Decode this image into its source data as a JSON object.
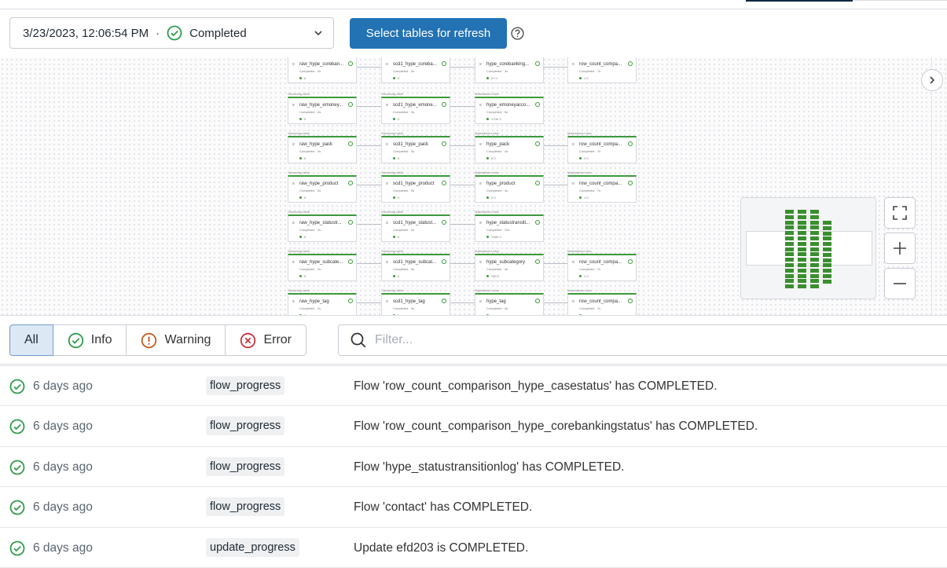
{
  "update_selector": {
    "datetime": "3/23/2023, 12:06:54 PM",
    "separator": "·",
    "status": "Completed"
  },
  "refresh_button": "Select tables for refresh",
  "graph": {
    "rows": [
      {
        "type": [
          "",
          "",
          "",
          ""
        ],
        "names": [
          "raw_hype_coreban...",
          "scd1_hype_coreba...",
          "hype_corebanking...",
          "row_count_compa..."
        ],
        "status": [
          "Completed · 2s",
          "Completed · 3s",
          "Completed · 3s",
          "Completed · 7s"
        ],
        "metrics": [
          "0",
          "0",
          "47   0",
          "1   0"
        ]
      },
      {
        "type": [
          "Streaming table",
          "Streaming table",
          "Materialized view",
          ""
        ],
        "names": [
          "raw_hype_emoney...",
          "scd1_hype_emone...",
          "hype_emoneyacco...",
          ""
        ],
        "status": [
          "Completed · 2s",
          "Completed · 3s",
          "Completed · 9s",
          ""
        ],
        "metrics": [
          "0",
          "0",
          "170K   0",
          ""
        ]
      },
      {
        "type": [
          "Streaming table",
          "Streaming table",
          "Materialized view",
          "Materialized view"
        ],
        "names": [
          "raw_hype_pack",
          "scd1_hype_pack",
          "hype_pack",
          "row_count_compa..."
        ],
        "status": [
          "Completed · 2s",
          "Completed · 3s",
          "Completed · 4s",
          "Completed · 7s"
        ],
        "metrics": [
          "0",
          "0",
          "6   0",
          "1   0"
        ]
      },
      {
        "type": [
          "Streaming table",
          "Streaming table",
          "Materialized view",
          "Materialized view"
        ],
        "names": [
          "raw_hype_product",
          "scd1_hype_product",
          "hype_product",
          "row_count_compa..."
        ],
        "status": [
          "Completed · 2s",
          "Completed · 3s",
          "Completed · 4s",
          "Completed · 7s"
        ],
        "metrics": [
          "0",
          "0",
          "4   0",
          "1   0"
        ]
      },
      {
        "type": [
          "Streaming table",
          "Streaming table",
          "Materialized view",
          ""
        ],
        "names": [
          "raw_hype_statustr...",
          "scd1_hype_statust...",
          "hype_statustransiti...",
          ""
        ],
        "status": [
          "Completed · 2s",
          "Completed · 3s",
          "Completed · 12s",
          ""
        ],
        "metrics": [
          "0",
          "0",
          "746K   0",
          ""
        ]
      },
      {
        "type": [
          "Streaming table",
          "Streaming table",
          "Materialized view",
          "Materialized view"
        ],
        "names": [
          "raw_hype_subcate...",
          "scd1_hype_subcat...",
          "hype_subcategory",
          "row_count_compa..."
        ],
        "status": [
          "Completed · 2s",
          "Completed · 3s",
          "Completed · 4s",
          "Completed · 7s"
        ],
        "metrics": [
          "0",
          "0",
          "780   0",
          "1   0"
        ]
      },
      {
        "type": [
          "Streaming table",
          "Streaming table",
          "Materialized view",
          "Materialized view"
        ],
        "names": [
          "raw_hype_tag",
          "scd1_hype_tag",
          "hype_tag",
          "row_count_compa..."
        ],
        "status": [
          "Completed · 2s",
          "Completed · 3s",
          "Completed · 4s",
          "Completed · 7s"
        ],
        "metrics": [
          "0",
          "0",
          "",
          ""
        ]
      }
    ]
  },
  "filters": [
    {
      "label": "All",
      "icon": "",
      "active": true
    },
    {
      "label": "Info",
      "icon": "info-check-icon",
      "color": "#2e9c4a"
    },
    {
      "label": "Warning",
      "icon": "warning-icon",
      "color": "#c25b1d"
    },
    {
      "label": "Error",
      "icon": "error-icon",
      "color": "#c8323c"
    }
  ],
  "search": {
    "placeholder": "Filter..."
  },
  "events": [
    {
      "time": "6 days ago",
      "type": "flow_progress",
      "message": "Flow 'row_count_comparison_hype_casestatus' has COMPLETED."
    },
    {
      "time": "6 days ago",
      "type": "flow_progress",
      "message": "Flow 'row_count_comparison_hype_corebankingstatus' has COMPLETED."
    },
    {
      "time": "6 days ago",
      "type": "flow_progress",
      "message": "Flow 'hype_statustransitionlog' has COMPLETED."
    },
    {
      "time": "6 days ago",
      "type": "flow_progress",
      "message": "Flow 'contact' has COMPLETED."
    },
    {
      "time": "6 days ago",
      "type": "update_progress",
      "message": "Update efd203 is COMPLETED."
    }
  ],
  "colors": {
    "primary": "#2272b4",
    "success": "#2e9c4a",
    "graph_green": "#3a8e2f"
  }
}
